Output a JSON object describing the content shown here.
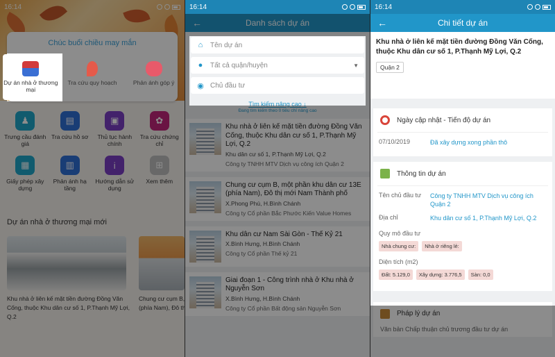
{
  "status_time": "16:14",
  "panel1": {
    "greeting": "Chúc buổi chiều may mắn",
    "quick": [
      {
        "label": "Dự án nhà ở thương mại",
        "icon": "house-icon"
      },
      {
        "label": "Tra cứu quy hoạch",
        "icon": "map-pin-icon"
      },
      {
        "label": "Phản ánh góp ý",
        "icon": "heart-chat-icon"
      }
    ],
    "grid": [
      {
        "label": "Trưng cầu đánh giá",
        "icon": "survey-icon",
        "color": "#1fa7c9"
      },
      {
        "label": "Tra cứu hồ sơ",
        "icon": "document-icon",
        "color": "#2f6fd6"
      },
      {
        "label": "Thủ tục hành chính",
        "icon": "procedure-icon",
        "color": "#7b3fc4"
      },
      {
        "label": "Tra cứu chứng chỉ",
        "icon": "certificate-icon",
        "color": "#c2257a"
      },
      {
        "label": "Giấy phép xây dựng",
        "icon": "permit-icon",
        "color": "#1fa7c9"
      },
      {
        "label": "Phản ánh hạ tầng",
        "icon": "infrastructure-icon",
        "color": "#2f6fd6"
      },
      {
        "label": "Hướng dẫn sử dụng",
        "icon": "info-icon",
        "color": "#7b3fc4"
      },
      {
        "label": "Xem thêm",
        "icon": "more-icon",
        "color": "#bdbdbd"
      }
    ],
    "section_title": "Dự án nhà ở thương mại mới",
    "project1": "Khu nhà ở liên kế mặt tiền đường Đồng Văn Cống, thuộc Khu dân cư số 1, P.Thạnh Mỹ Lợi, Q.2",
    "project2": "Chung cư cụm B, một phần khu dân cư 13E (phía Nam), Đô thị mới Nam Thành phố"
  },
  "panel2": {
    "title": "Danh sách dự án",
    "fields": {
      "name_placeholder": "Tên dự án",
      "district_value": "Tất cả quận/huyện",
      "owner_placeholder": "Chủ đầu tư"
    },
    "advanced": "Tìm kiếm nâng cao",
    "advanced_sub": "Đang tìm kiếm theo 0 tiêu chí nâng cao",
    "items": [
      {
        "title": "Khu nhà ở liên kế mặt tiền đường Đồng Văn Cống, thuộc Khu dân cư số 1, P.Thạnh Mỹ Lợi, Q.2",
        "address": "Khu dân cư số 1, P.Thạnh Mỹ Lợi, Q.2",
        "company": "Công ty TNHH MTV Dịch vụ công ích Quận 2"
      },
      {
        "title": "Chung cư cụm B, một phần khu dân cư 13E (phía Nam), Đô thị mới Nam Thành phố",
        "address": "X.Phong Phú, H.Bình Chánh",
        "company": "Công ty Cổ phần Bắc Phước Kiến Value Homes"
      },
      {
        "title": "Khu dân cư Nam Sài Gòn - Thế Kỷ 21",
        "address": "X.Bình Hưng, H.Bình Chánh",
        "company": "Công ty Cổ phần Thế kỷ 21"
      },
      {
        "title": "Giai đoạn 1 - Công trình nhà ở Khu nhà ở Nguyễn Sơn",
        "address": "X.Bình Hưng, H.Bình Chánh",
        "company": "Công ty Cổ phần Bất động sản Nguyễn Sơn"
      }
    ]
  },
  "panel3": {
    "title": "Chi tiết dự án",
    "project_title": "Khu nhà ở liên kế mặt tiền đường Đồng Văn Cống, thuộc Khu dân cư số 1, P.Thạnh Mỹ Lợi, Q.2",
    "district_badge": "Quận 2",
    "progress": {
      "header": "Ngày cập nhật - Tiến độ dự án",
      "date": "07/10/2019",
      "status": "Đã xây dựng xong phần thô"
    },
    "info": {
      "header": "Thông tin dự án",
      "owner_label": "Tên chủ đầu tư",
      "owner_value": "Công ty TNHH MTV Dịch vụ công ích Quận 2",
      "address_label": "Địa chỉ",
      "address_value": "Khu dân cư số 1, P.Thạnh Mỹ Lợi, Q.2",
      "scale_label": "Quy mô đầu tư",
      "scale_tags": [
        "Nhà chung cư:",
        "Nhà ở riêng lẻ:"
      ],
      "area_label": "Diện tích (m2)",
      "area_tags": [
        "Đất: 5.129,0",
        "Xây dựng: 3.776,5",
        "Sàn: 0,0"
      ]
    },
    "legal": {
      "header": "Pháp lý dự án",
      "text": "Văn bản Chấp thuận chủ trương đầu tư dự án"
    }
  }
}
